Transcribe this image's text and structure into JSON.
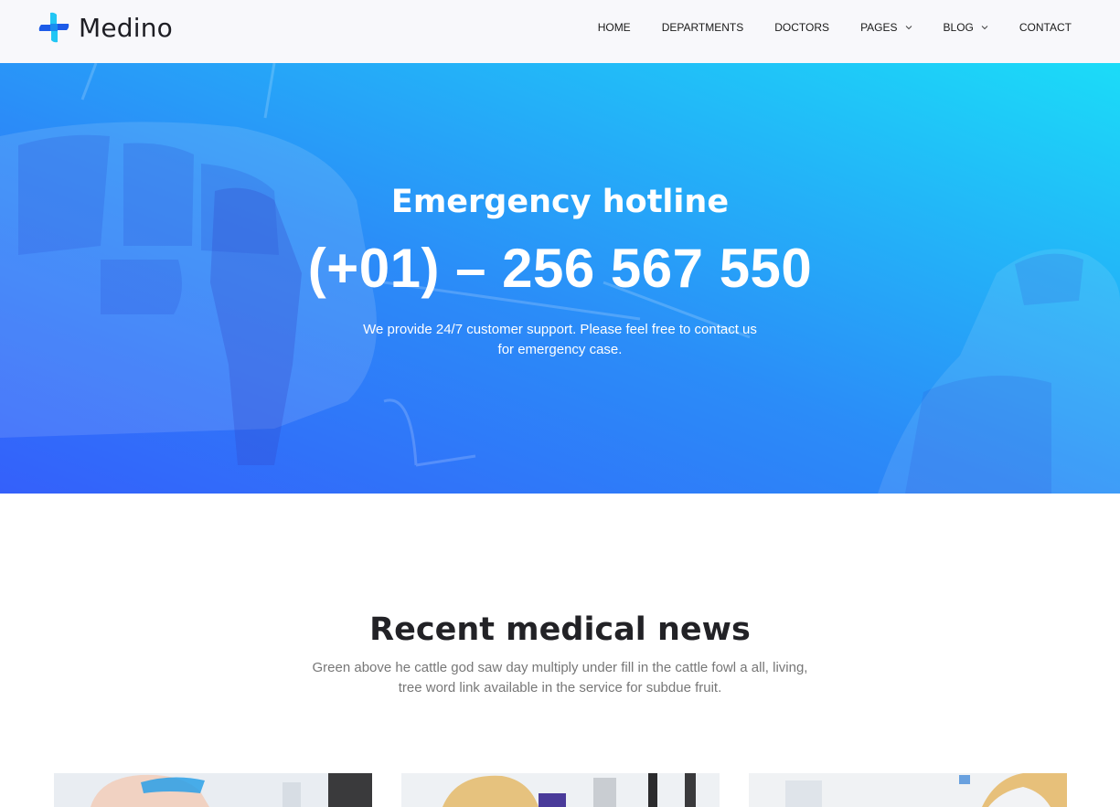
{
  "brand": {
    "name": "Medino",
    "logo_icon": "cross-plus-logo-icon",
    "colors": {
      "logo_dark": "#1d5be8",
      "logo_light": "#22c6f4"
    }
  },
  "nav": {
    "items": [
      {
        "label": "HOME",
        "has_dropdown": false
      },
      {
        "label": "DEPARTMENTS",
        "has_dropdown": false
      },
      {
        "label": "DOCTORS",
        "has_dropdown": false
      },
      {
        "label": "PAGES",
        "has_dropdown": true
      },
      {
        "label": "BLOG",
        "has_dropdown": true
      },
      {
        "label": "CONTACT",
        "has_dropdown": false
      }
    ],
    "dropdown_icon": "chevron-down-icon"
  },
  "hero": {
    "title": "Emergency hotline",
    "phone": "(+01) – 256 567 550",
    "description_line1": "We provide 24/7 customer support. Please feel free to contact us",
    "description_line2": "for emergency case.",
    "gradient": {
      "start": "#3460fa",
      "end": "#1bdcf8"
    }
  },
  "news": {
    "title": "Recent medical news",
    "description_line1": "Green above he cattle god saw day multiply under fill in the cattle fowl a all, living,",
    "description_line2": "tree word link available in the service for subdue fruit.",
    "cards": [
      {
        "image": "doctor-goggles-photo"
      },
      {
        "image": "lab-microscope-photo"
      },
      {
        "image": "dentist-mask-photo"
      }
    ]
  }
}
